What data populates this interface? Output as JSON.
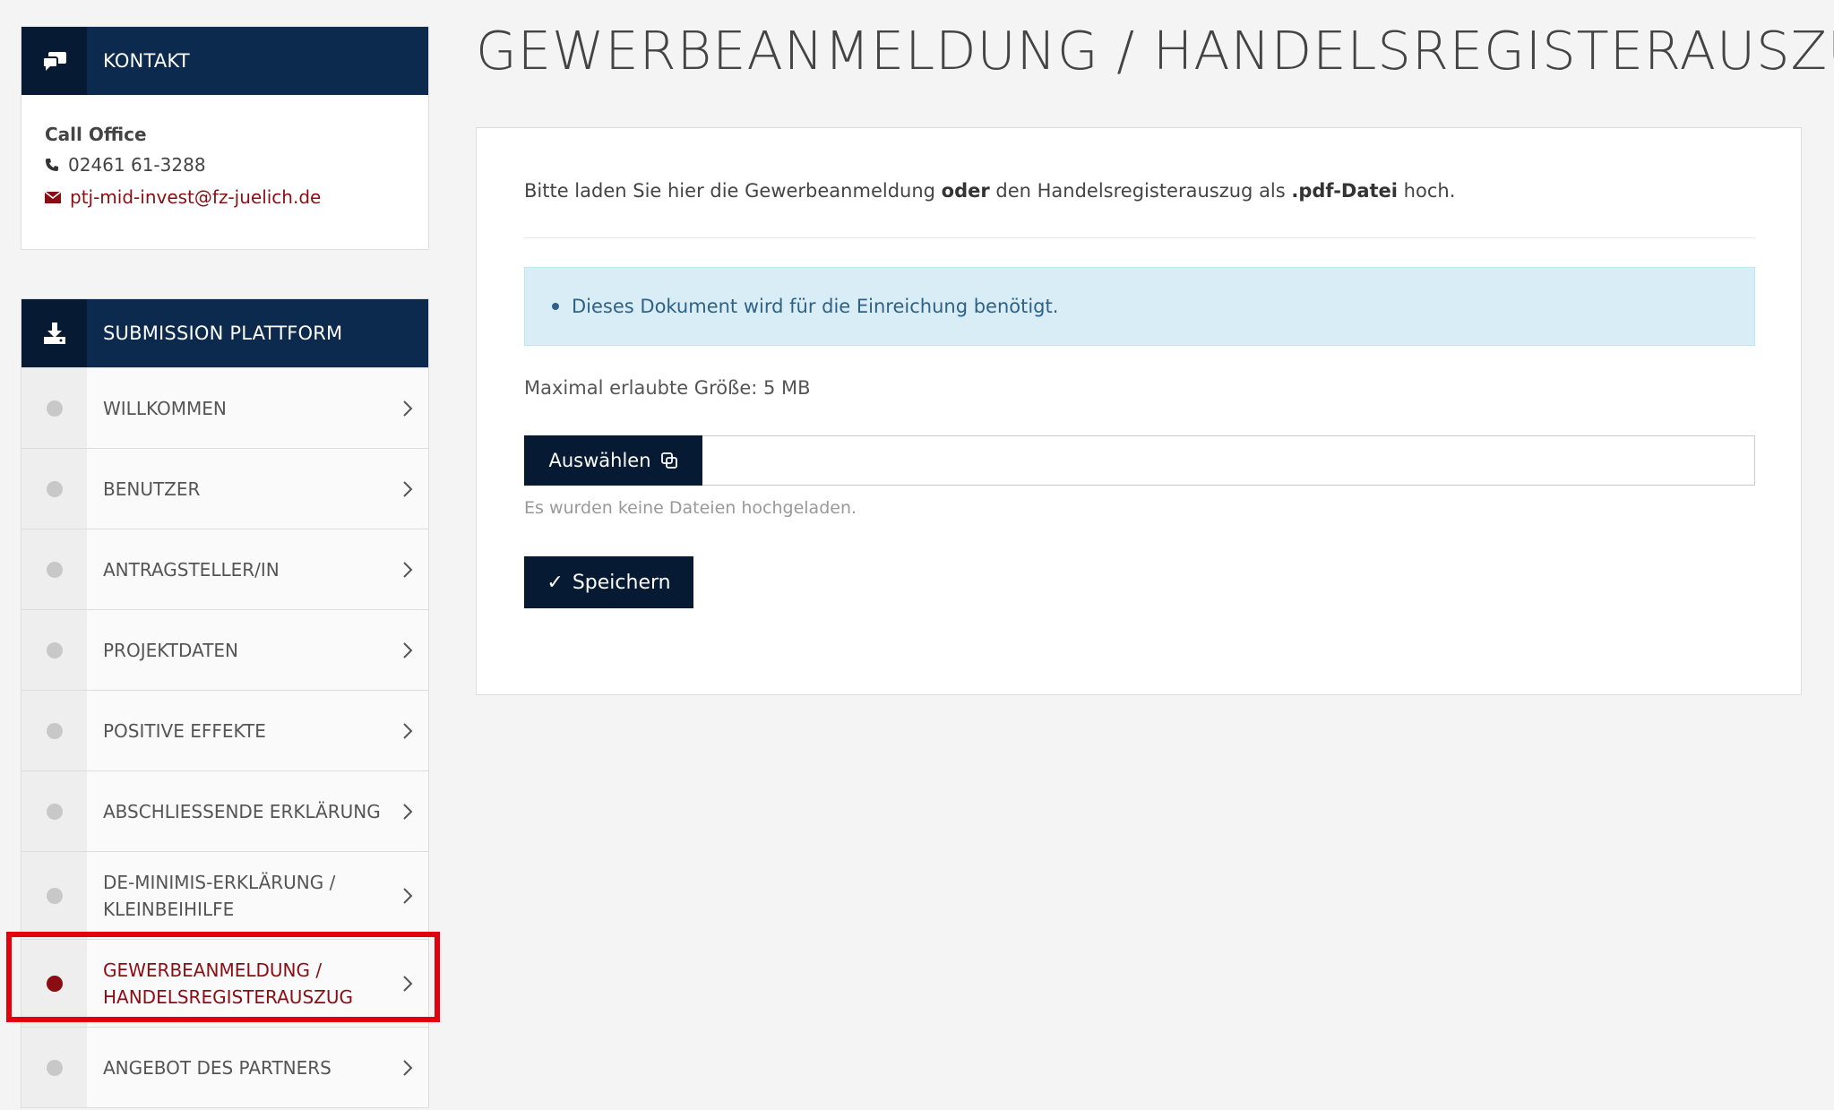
{
  "page": {
    "title": "GEWERBEANMELDUNG / HANDELSREGISTERAUSZUG"
  },
  "contact": {
    "header": "KONTAKT",
    "office_label": "Call Office",
    "phone": "02461 61-3288",
    "email": "ptj-mid-invest@fz-juelich.de"
  },
  "submission": {
    "header": "SUBMISSION PLATTFORM",
    "items": [
      {
        "label": "WILLKOMMEN"
      },
      {
        "label": "BENUTZER"
      },
      {
        "label": "ANTRAGSTELLER/IN"
      },
      {
        "label": "PROJEKTDATEN"
      },
      {
        "label": "POSITIVE EFFEKTE"
      },
      {
        "label": "ABSCHLIESSENDE ERKLÄRUNG"
      },
      {
        "label_line1": "DE-MINIMIS-ERKLÄRUNG /",
        "label_line2": "KLEINBEIHILFE"
      },
      {
        "label_line1": "GEWERBEANMELDUNG /",
        "label_line2": "HANDELSREGISTERAUSZUG",
        "active": true
      },
      {
        "label": "ANGEBOT DES PARTNERS"
      }
    ]
  },
  "main": {
    "intro_part1": "Bitte laden Sie hier die Gewerbeanmeldung ",
    "intro_bold1": "oder",
    "intro_part2": " den Handelsregisterauszug als ",
    "intro_bold2": ".pdf-Datei",
    "intro_part3": " hoch.",
    "info": "Dieses Dokument wird für die Einreichung benötigt.",
    "max_size": "Maximal erlaubte Größe: 5 MB",
    "choose_label": "Auswählen",
    "file_value": "",
    "hint": "Es wurden keine Dateien hochgeladen.",
    "save_label": "Speichern"
  },
  "colors": {
    "navy": "#0b2a4e",
    "navy_dark": "#061b33",
    "accent_red": "#8b0d14",
    "highlight_frame": "#e3000f",
    "info_bg": "#d9edf7"
  }
}
